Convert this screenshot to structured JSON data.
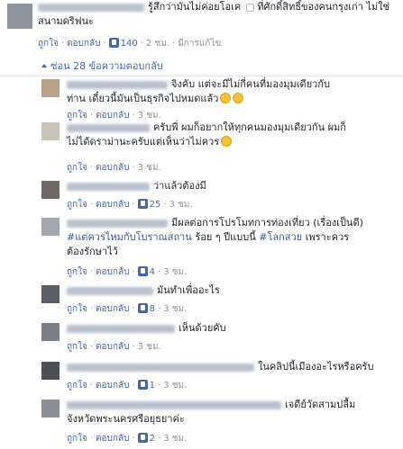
{
  "top_comment": {
    "text_line1": "รู้สึกว่ามันไม่ค่อยโอเค",
    "text_line1b": "ที่ศักดิ์สิทธิ์ของคนกรุงเก่า ไม่ใช่",
    "text_line2": "สนามดริฟนะ",
    "like_label": "ถูกใจ",
    "reply_label": "ตอบกลับ",
    "like_count": "140",
    "time": "2 ชม.",
    "edited": "มีการแก้ไข"
  },
  "replies_toggle": "ซ่อน 28 ข้อความตอบกลับ",
  "replies": [
    {
      "lines": [
        "จิงคับ แต่จะมีไม่กี่คนที่มองมุมเดียวกับ",
        "ท่าน เดี๋ยวนี้มันเป็นธุรกิจไปหมดแล้ว"
      ],
      "emoji": 2,
      "like_count": "",
      "time": "3 ชม."
    },
    {
      "lines": [
        "ครับพี่ ผมก็อยากให้ทุกคนมองมุมเดียวกัน ผมก็",
        "ไม่ได้ดราม่านะครับแต่เห็นว่าไม่ควร"
      ],
      "emoji": 1,
      "like_count": "",
      "time": "3 ชม."
    },
    {
      "lines": [
        "ว่าแล้วต้องมี"
      ],
      "emoji": 0,
      "like_count": "25",
      "time": "3 ชม."
    },
    {
      "lines": [
        "มีผลต่อการโปรโมทการท่องเที่ยว (เรื่องเป็นดี)",
        "#แต่ควรไหมกับโบราณสถาน ร้อย ๆ ปีแบบนี้ #โลกสวย เพราะควร",
        "ต้องรักษาไว้"
      ],
      "emoji": 0,
      "like_count": "4",
      "time": "3 ชม."
    },
    {
      "lines": [
        "มันทำเพื่ออะไร"
      ],
      "emoji": 0,
      "like_count": "8",
      "time": "3 ชม."
    },
    {
      "lines": [
        "เห็นด้วยคับ"
      ],
      "emoji": 0,
      "like_count": "",
      "time": "3 ชม."
    },
    {
      "lines": [
        "ในคลิปนี้เมืองอะไรหรือครับ"
      ],
      "emoji": 0,
      "like_count": "1",
      "time": "3 ชม."
    },
    {
      "lines": [
        "เจดีย์วัดสามปลื้ม",
        "จังหวัดพระนครศรีอยุธยาค่ะ"
      ],
      "emoji": 0,
      "like_count": "2",
      "time": "3 ชม."
    }
  ],
  "labels": {
    "like": "ถูกใจ",
    "reply": "ตอบกลับ"
  },
  "colors": {
    "link": "#4267b2",
    "meta": "#90949c",
    "text": "#1d2129",
    "hashtag": "#365899"
  }
}
